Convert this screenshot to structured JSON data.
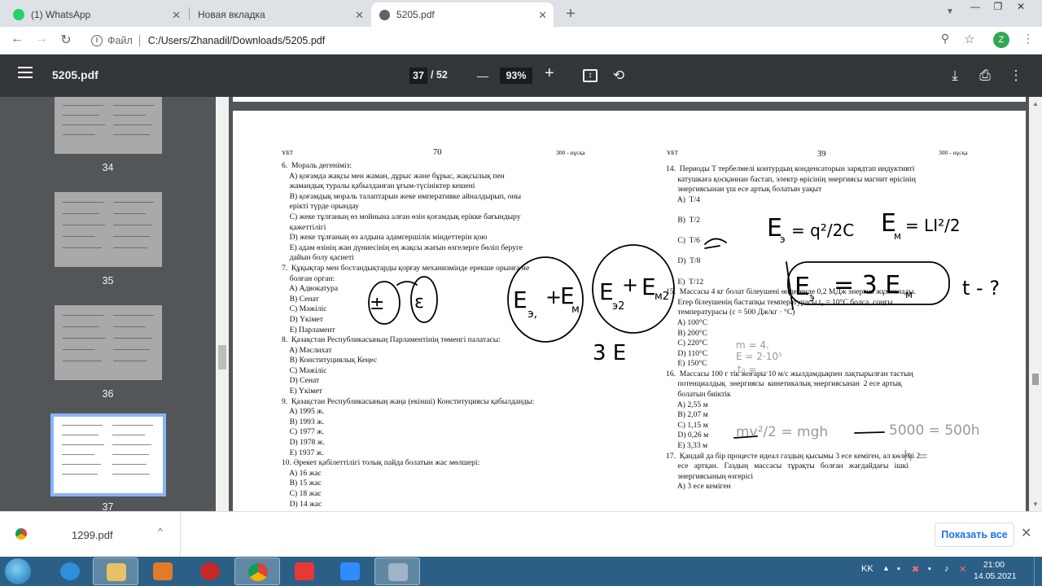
{
  "browser": {
    "tabs": [
      {
        "title": "(1) WhatsApp",
        "close": "✕"
      },
      {
        "title": "Новая вкладка",
        "close": "✕"
      },
      {
        "title": "5205.pdf",
        "close": "✕"
      }
    ],
    "new_tab": "+",
    "window_controls": [
      "—",
      "❐",
      "✕"
    ],
    "address_scheme": "Файл",
    "address_path": "C:/Users/Zhanadil/Downloads/5205.pdf",
    "profile_initial": "Z"
  },
  "pdf_toolbar": {
    "file_title": "5205.pdf",
    "current_page": "37",
    "total_pages": "/ 52",
    "zoom": "93%",
    "zoom_out": "—",
    "zoom_in": "+"
  },
  "thumbnails": [
    {
      "label": "34"
    },
    {
      "label": "35"
    },
    {
      "label": "36"
    },
    {
      "label": "37"
    }
  ],
  "document": {
    "left": {
      "header_left": "ҰБТ",
      "page_number": "70",
      "header_right": "300 - нұсқа",
      "lines": [
        "6.  Мораль дегеніміз:",
        "    A) қоғамда жақсы мен жаман, дұрыс және бұрыс, жақсылық пен",
        "    жамандық туралы қабылданған ұғым-түсініктер кешені",
        "    B) қоғамдық мораль талаптарын жеке императивке айналдырып, оны",
        "    ерікті түрде орындау",
        "    C) жеке тұлғаның өз мойнына алған өзін қоғамдық ерікке бағындыру",
        "    қажеттілігі",
        "    D) жеке тұлғаның өз алдына адамгершілік міндеттерін қою",
        "    E) адам өзінің жан дүниесінің ең жақсы жағын өзгелерге бөліп беруге",
        "    дайын болу қасиеті",
        "7.  Құқықтар мен бостандықтарды қорғау механизмінде ерекше орынға ие",
        "    болған орган:",
        "    A) Адвокатура",
        "    B) Сенат",
        "    C) Мәжіліс",
        "    D) Үкімет",
        "    E) Парламент",
        "8.  Қазақстан Республикасының Парламентінің төменгі палатасы:",
        "    A) Мәслихат",
        "    B) Конституциялық Кеңес",
        "    C) Мәжіліс",
        "    D) Сенат",
        "    E) Үкімет",
        "9.  Қазақстан Республикасының жаңа (екінші) Конституциясы қабылданды:",
        "    A) 1995 ж.",
        "    B) 1993 ж.",
        "    C) 1977 ж.",
        "    D) 1978 ж.",
        "    E) 1937 ж.",
        "10. Әрекет қабілеттілігі толық пайда болатын жас мөлшері:",
        "    A) 16 жас",
        "    B) 15 жас",
        "    C) 18 жас",
        "    D) 14 жас"
      ]
    },
    "right": {
      "header_left": "ҰБТ",
      "page_number": "39",
      "header_right": "300 - нұсқа",
      "lines": [
        "14.  Периоды T тербелмелі контурдың конденсаторын зарядтап индуктивті",
        "      катушкаға қосқаннан бастап, электр өрісінің энергиясы магнит өрісінің",
        "      энергиясынан үш есе артық болатын уақыт",
        "      A)  T/4",
        "",
        "      B)  T/2",
        "",
        "      C)  T/6",
        "",
        "      D)  T/8",
        "",
        "      E)  T/12",
        "15.  Массасы 4 кг болат білеушені өңдегенде 0,2 МДж энергия жұмсалады.",
        "      Егер білеушенің бастапқы температурасы t₀ = 10°С болса, соңғы",
        "      температурасы (c = 500 Дж/кг · °С)",
        "      A) 100°С",
        "      B) 200°С",
        "      C) 220°С",
        "      D) 110°С",
        "      E) 150°С",
        "16.  Массасы 100 г тік жоғары 10 м/с жылдамдықпен лақтырылған тастың",
        "      потенциалдық  энергиясы  кинетикалық энергиясынан  2 есе артық",
        "      болатын биіктік",
        "      A) 2,55 м",
        "      B) 2,07 м",
        "      C) 1,15 м",
        "      D) 0,26 м",
        "      E) 3,33 м",
        "17.  Қандай да бір процесте идеал газдың қысымы 3 есе кеміген, ал көлемі 2",
        "      есе   артқан.   Газдың   массасы   тұрақты   болған   жағдайдағы   ішкі",
        "      энергиясының өзгерісі",
        "      A) 3 есе кеміген"
      ]
    }
  },
  "handwriting": {
    "e1": "E",
    "e1_sub": "э,",
    "plus1": "+",
    "e2": "E",
    "e2_sub": "м,",
    "e3": "E",
    "e3_sub": "э2",
    "plus2": "+",
    "e4": "E",
    "e4_sub": "м2",
    "three_e": "3 E",
    "f1_lhs": "E",
    "f1_sub": "э",
    "f1_rhs": "= q²/2C",
    "f2_lhs": "E",
    "f2_sub": "м",
    "f2_rhs": "= LI²/2",
    "boxed": "E",
    "boxed_sub": "э",
    "boxed_rhs": "= 3 E",
    "boxed_rhs_sub": "м",
    "t_q": "t - ?",
    "mass": "m = 4.",
    "energy": "E = 2·10⁵",
    "t0": "t₀ = ...",
    "f3": "mv²/2 = mgh",
    "f4": "5000 = 500h",
    "f5": "h ="
  },
  "downloads": {
    "file_name": "1299.pdf",
    "chevron": "^",
    "show_all": "Показать все",
    "close": "✕"
  },
  "taskbar": {
    "lang": "KK",
    "time": "21:00",
    "date": "14.05.2021"
  }
}
